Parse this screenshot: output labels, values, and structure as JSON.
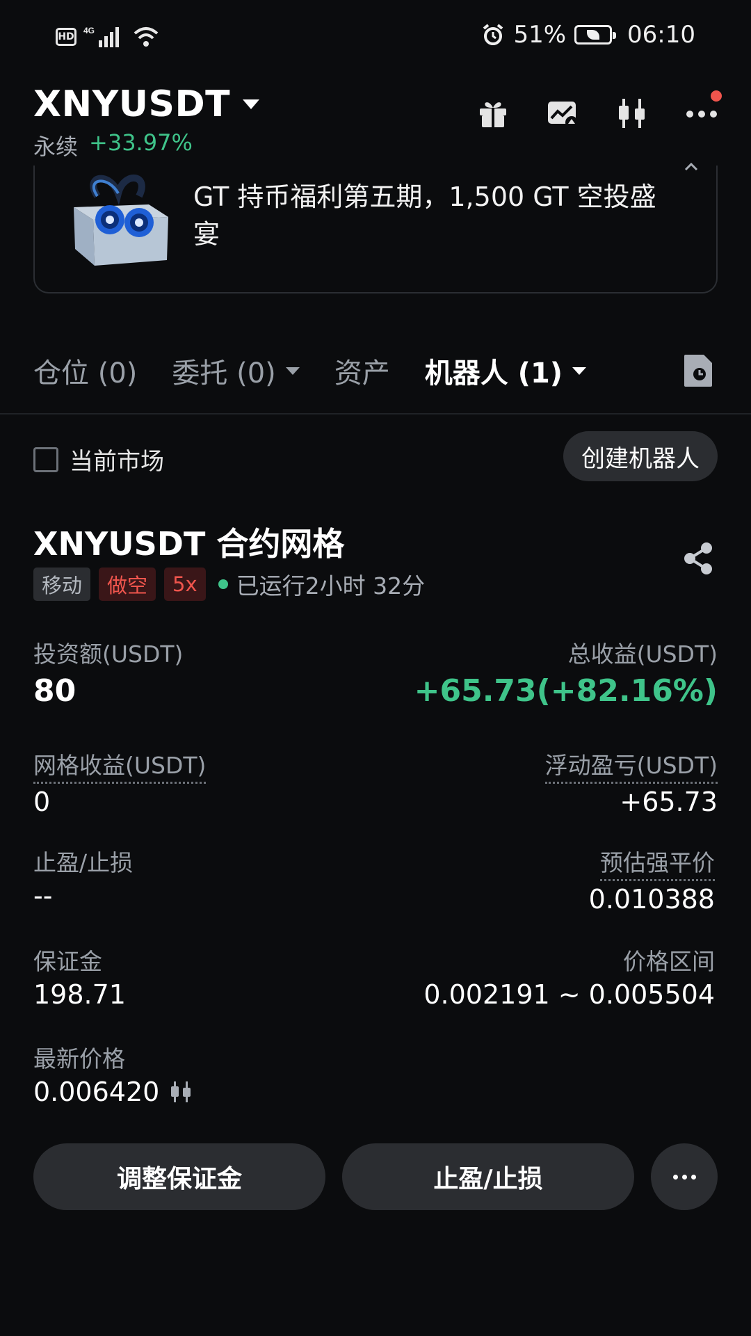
{
  "status_bar": {
    "hd": "HD",
    "network": "4G",
    "battery_pct": "51%",
    "time": "06:10"
  },
  "header": {
    "pair": "XNYUSDT",
    "contract_type": "永续",
    "change": "+33.97%"
  },
  "banner": {
    "text": "GT 持币福利第五期，1,500 GT 空投盛宴"
  },
  "tabs": [
    {
      "label": "仓位 (0)"
    },
    {
      "label": "委托 (0)"
    },
    {
      "label": "资产"
    },
    {
      "label": "机器人 (1)"
    }
  ],
  "filter": {
    "current_market": "当前市场",
    "create_bot": "创建机器人"
  },
  "bot": {
    "title": "XNYUSDT 合约网格",
    "tags": [
      "移动",
      "做空",
      "5x"
    ],
    "runtime": "已运行2小时 32分",
    "investment_label": "投资额(USDT)",
    "investment_value": "80",
    "total_profit_label": "总收益(USDT)",
    "total_profit_value": "+65.73(+82.16%)",
    "grid_profit_label": "网格收益(USDT)",
    "grid_profit_value": "0",
    "floating_pnl_label": "浮动盈亏(USDT)",
    "floating_pnl_value": "+65.73",
    "tpsl_label": "止盈/止损",
    "tpsl_value": "--",
    "liq_price_label": "预估强平价",
    "liq_price_value": "0.010388",
    "margin_label": "保证金",
    "margin_value": "198.71",
    "price_range_label": "价格区间",
    "price_range_value": "0.002191 ~ 0.005504",
    "last_price_label": "最新价格",
    "last_price_value": "0.006420"
  },
  "actions": {
    "adjust_margin": "调整保证金",
    "tpsl": "止盈/止损"
  },
  "colors": {
    "background": "#0b0c0e",
    "up_green": "#3fc48a",
    "down_red": "#f0554d",
    "pill_bg": "#2b2d31"
  }
}
